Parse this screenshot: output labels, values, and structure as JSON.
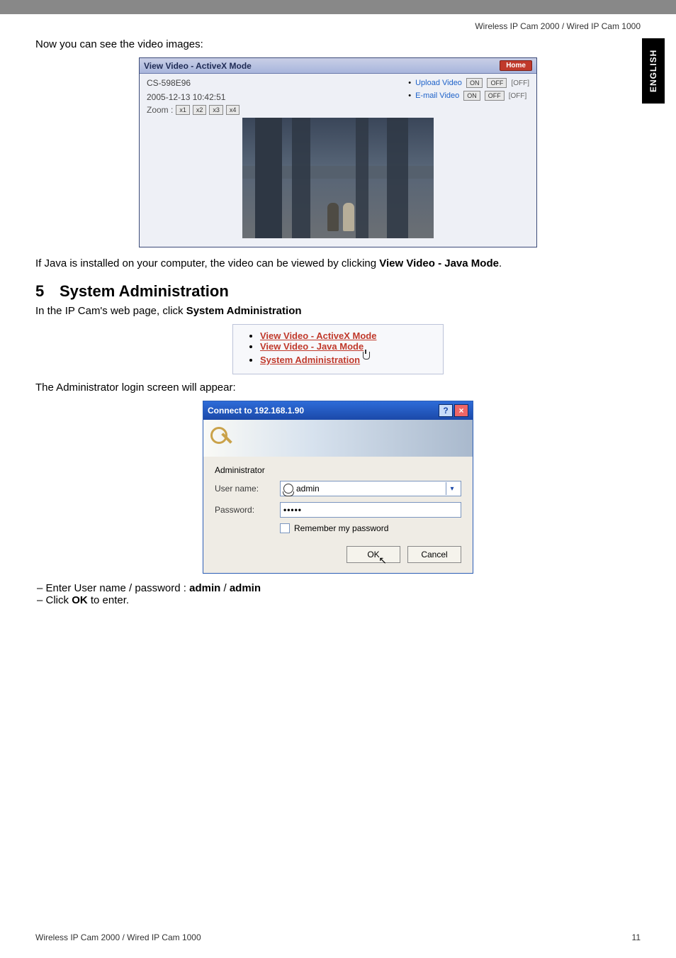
{
  "header": {
    "product_line": "Wireless IP Cam 2000 / Wired IP Cam 1000"
  },
  "side_tab": "ENGLISH",
  "intro_line": "Now you can see the video images:",
  "activex_box": {
    "title": "View Video - ActiveX Mode",
    "home": "Home",
    "cam_id": "CS-598E96",
    "timestamp": "2005-12-13 10:42:51",
    "upload_label": "Upload Video",
    "email_label": "E-mail Video",
    "btn_on": "ON",
    "btn_off": "OFF",
    "state_off": "[OFF]",
    "zoom_label": "Zoom :",
    "zoom_levels": [
      "x1",
      "x2",
      "x3",
      "x4"
    ]
  },
  "java_note_pre": "If Java is installed on your computer, the video can be viewed by clicking ",
  "java_note_bold": "View Video - Java Mode",
  "java_note_post": ".",
  "section5": {
    "num": "5",
    "title": "System Administration"
  },
  "sysadmin_intro_pre": "In the IP Cam's web page, click ",
  "sysadmin_intro_bold": "System Administration",
  "menu_links": {
    "a": "View Video - ActiveX Mode",
    "b": "View Video - Java Mode",
    "c": "System Administration"
  },
  "admin_login_line": "The Administrator login screen will appear:",
  "login": {
    "title": "Connect to 192.168.1.90",
    "realm": "Administrator",
    "username_label": "User name:",
    "username_value": "admin",
    "password_label": "Password:",
    "password_mask": "•••••",
    "remember": "Remember my password",
    "ok": "OK",
    "cancel": "Cancel"
  },
  "steps": {
    "enter_pre": "Enter User name / password : ",
    "enter_user": "admin",
    "enter_sep": " / ",
    "enter_pass": "admin",
    "click_pre": "Click ",
    "click_bold": "OK",
    "click_post": " to enter."
  },
  "footer": {
    "left": "Wireless IP Cam 2000 / Wired IP Cam 1000",
    "page": "11"
  }
}
